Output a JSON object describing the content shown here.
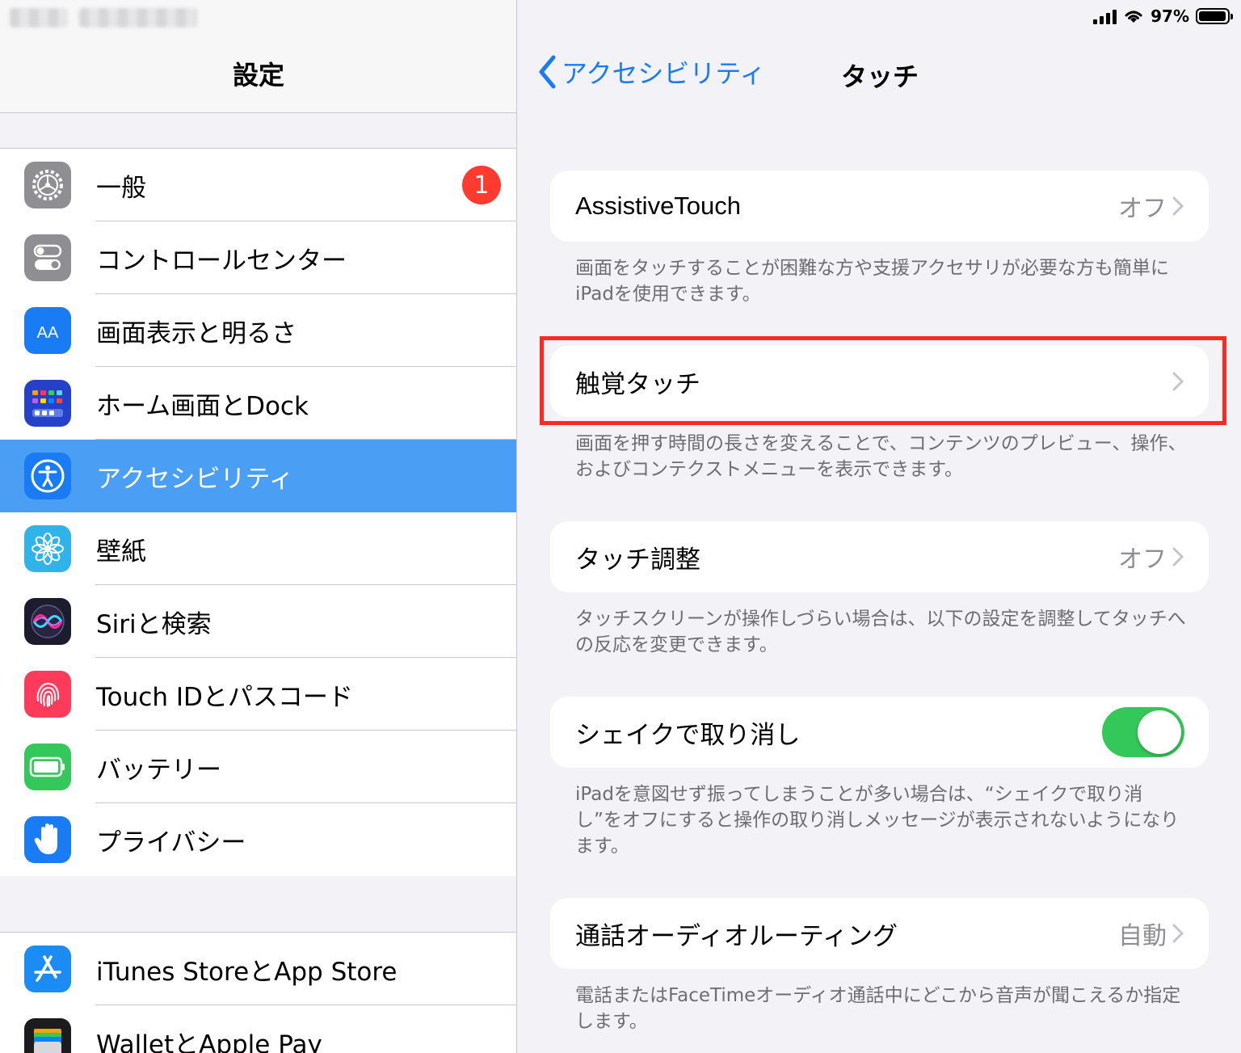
{
  "colors": {
    "accent": "#1a7cf4",
    "selected_row": "#4a9ff5",
    "badge": "#ff3b30",
    "toggle_on": "#34c759",
    "highlight_box": "#fb2a22"
  },
  "left_panel": {
    "title": "設定",
    "items": [
      {
        "label": "一般",
        "icon": "gear-icon",
        "badge": "1"
      },
      {
        "label": "コントロールセンター",
        "icon": "toggles-icon"
      },
      {
        "label": "画面表示と明るさ",
        "icon": "text-size-icon",
        "icon_text": "AA"
      },
      {
        "label": "ホーム画面とDock",
        "icon": "home-grid-icon"
      },
      {
        "label": "アクセシビリティ",
        "icon": "accessibility-icon",
        "selected": true
      },
      {
        "label": "壁紙",
        "icon": "flower-icon"
      },
      {
        "label": "Siriと検索",
        "icon": "siri-icon"
      },
      {
        "label": "Touch IDとパスコード",
        "icon": "fingerprint-icon"
      },
      {
        "label": "バッテリー",
        "icon": "battery-icon"
      },
      {
        "label": "プライバシー",
        "icon": "hand-icon"
      }
    ],
    "items2": [
      {
        "label": "iTunes StoreとApp Store",
        "icon": "app-store-icon"
      },
      {
        "label": "WalletとApple Pay",
        "icon": "wallet-icon"
      }
    ]
  },
  "status_bar": {
    "battery_percent": "97%",
    "battery_level": 0.97
  },
  "right_panel": {
    "back_label": "アクセシビリティ",
    "title": "タッチ",
    "rows": [
      {
        "label": "AssistiveTouch",
        "value": "オフ",
        "footnote": "画面をタッチすることが困難な方や支援アクセサリが必要な方も簡単にiPadを使用できます。"
      },
      {
        "label": "触覚タッチ",
        "value": "",
        "footnote": "画面を押す時間の長さを変えることで、コンテンツのプレビュー、操作、およびコンテクストメニューを表示できます。"
      },
      {
        "label": "タッチ調整",
        "value": "オフ",
        "footnote": "タッチスクリーンが操作しづらい場合は、以下の設定を調整してタッチへの反応を変更できます。"
      },
      {
        "label": "シェイクで取り消し",
        "toggle_on": true,
        "footnote": "iPadを意図せず振ってしまうことが多い場合は、“シェイクで取り消し”をオフにすると操作の取り消しメッセージが表示されないようになります。"
      },
      {
        "label": "通話オーディオルーティング",
        "value": "自動",
        "footnote": "電話またはFaceTimeオーディオ通話中にどこから音声が聞こえるか指定します。"
      }
    ]
  }
}
